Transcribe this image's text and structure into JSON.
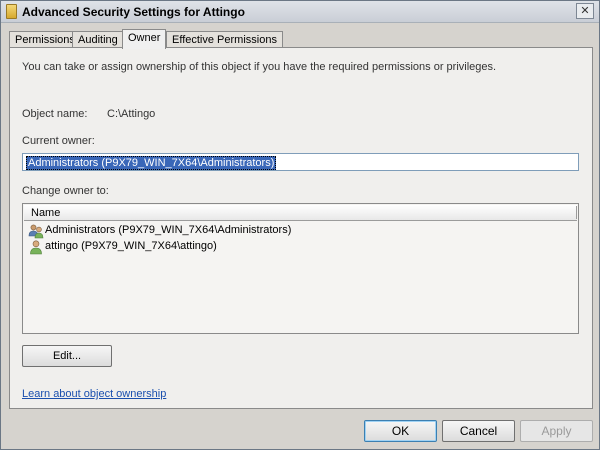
{
  "window": {
    "title": "Advanced Security Settings for Attingo",
    "close_glyph": "✕"
  },
  "tabs": [
    {
      "label": "Permissions"
    },
    {
      "label": "Auditing"
    },
    {
      "label": "Owner",
      "active": true
    },
    {
      "label": "Effective Permissions"
    }
  ],
  "owner_page": {
    "intro": "You can take or assign ownership of this object if you have the required permissions or privileges.",
    "object_name_label": "Object name:",
    "object_name_value": "C:\\Attingo",
    "current_owner_label": "Current owner:",
    "current_owner_value": "Administrators (P9X79_WIN_7X64\\Administrators)",
    "change_owner_label": "Change owner to:",
    "list_header": "Name",
    "owners": [
      {
        "name": "Administrators (P9X79_WIN_7X64\\Administrators)",
        "icon": "group-icon"
      },
      {
        "name": "attingo (P9X79_WIN_7X64\\attingo)",
        "icon": "user-icon"
      }
    ],
    "edit_button": "Edit...",
    "learn_link": "Learn about object ownership"
  },
  "buttons": {
    "ok": "OK",
    "cancel": "Cancel",
    "apply": "Apply"
  },
  "colors": {
    "selection": "#3a67b8",
    "link": "#1a4fae"
  }
}
